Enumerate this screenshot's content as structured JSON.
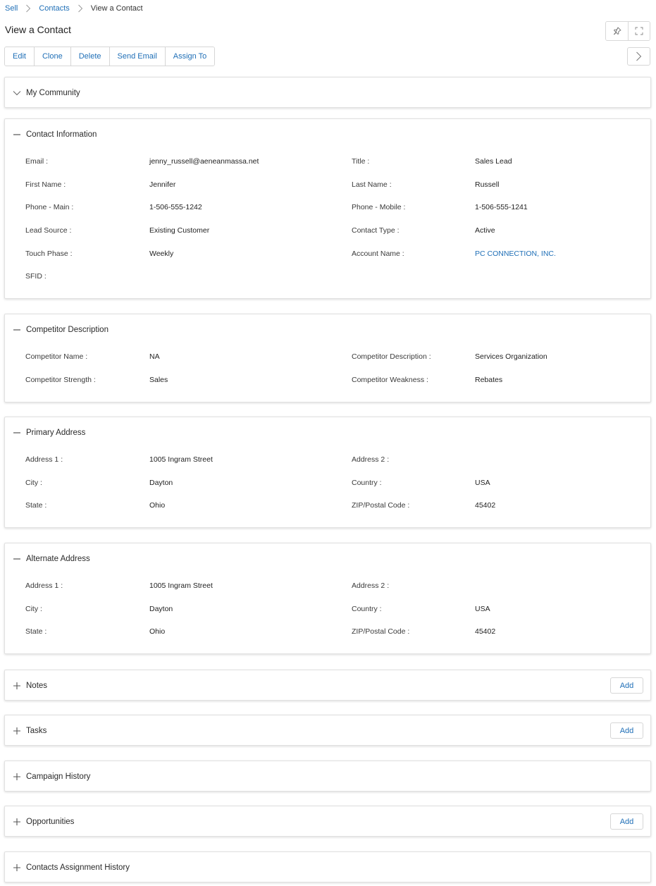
{
  "breadcrumb": {
    "items": [
      {
        "label": "Sell"
      },
      {
        "label": "Contacts"
      }
    ],
    "current": "View a Contact"
  },
  "page": {
    "title": "View a Contact"
  },
  "toolbar": {
    "tools": [
      {
        "icon": "pin-icon"
      },
      {
        "icon": "fullscreen-icon"
      }
    ],
    "actions": [
      "Edit",
      "Clone",
      "Delete",
      "Send Email",
      "Assign To"
    ],
    "next_icon": "chevron-right-icon"
  },
  "colors": {
    "link": "#1f6fb7",
    "border": "#d6d6d6"
  },
  "sections": {
    "my_community": {
      "title": "My Community",
      "state": "collapsed",
      "icon": "chevron-down-icon"
    },
    "contact_info": {
      "title": "Contact Information",
      "state": "expanded",
      "icon": "minus-icon",
      "rows": [
        [
          {
            "label": "Email :",
            "value": "jenny_russell@aeneanmassa.net"
          },
          {
            "label": "Title :",
            "value": "Sales Lead"
          }
        ],
        [
          {
            "label": "First Name :",
            "value": "Jennifer"
          },
          {
            "label": "Last Name :",
            "value": "Russell"
          }
        ],
        [
          {
            "label": "Phone - Main :",
            "value": "1-506-555-1242"
          },
          {
            "label": "Phone - Mobile :",
            "value": "1-506-555-1241"
          }
        ],
        [
          {
            "label": "Lead Source :",
            "value": "Existing Customer"
          },
          {
            "label": "Contact Type :",
            "value": "Active"
          }
        ],
        [
          {
            "label": "Touch Phase :",
            "value": "Weekly"
          },
          {
            "label": "Account Name :",
            "value": "PC CONNECTION, INC."
          }
        ],
        [
          {
            "label": "SFID :",
            "value": ""
          }
        ]
      ]
    },
    "competitor": {
      "title": "Competitor Description",
      "state": "expanded",
      "icon": "minus-icon",
      "rows": [
        [
          {
            "label": "Competitor Name :",
            "value": "NA"
          },
          {
            "label": "Competitor Description :",
            "value": "Services Organization"
          }
        ],
        [
          {
            "label": "Competitor Strength :",
            "value": "Sales"
          },
          {
            "label": "Competitor Weakness :",
            "value": "Rebates"
          }
        ]
      ]
    },
    "primary_address": {
      "title": "Primary Address",
      "state": "expanded",
      "icon": "minus-icon",
      "rows": [
        [
          {
            "label": "Address 1 :",
            "value": "1005 Ingram Street"
          },
          {
            "label": "Address 2 :",
            "value": ""
          }
        ],
        [
          {
            "label": "City :",
            "value": "Dayton"
          },
          {
            "label": "Country :",
            "value": "USA"
          }
        ],
        [
          {
            "label": "State :",
            "value": "Ohio"
          },
          {
            "label": "ZIP/Postal Code :",
            "value": "45402"
          }
        ]
      ]
    },
    "alternate_address": {
      "title": "Alternate Address",
      "state": "expanded",
      "icon": "minus-icon",
      "rows": [
        [
          {
            "label": "Address 1 :",
            "value": "1005 Ingram Street"
          },
          {
            "label": "Address 2 :",
            "value": ""
          }
        ],
        [
          {
            "label": "City :",
            "value": "Dayton"
          },
          {
            "label": "Country :",
            "value": "USA"
          }
        ],
        [
          {
            "label": "State :",
            "value": "Ohio"
          },
          {
            "label": "ZIP/Postal Code :",
            "value": "45402"
          }
        ]
      ]
    },
    "notes": {
      "title": "Notes",
      "state": "collapsed",
      "icon": "plus-icon",
      "add_label": "Add"
    },
    "tasks": {
      "title": "Tasks",
      "state": "collapsed",
      "icon": "plus-icon",
      "add_label": "Add"
    },
    "campaign_history": {
      "title": "Campaign History",
      "state": "collapsed",
      "icon": "plus-icon"
    },
    "opportunities": {
      "title": "Opportunities",
      "state": "collapsed",
      "icon": "plus-icon",
      "add_label": "Add"
    },
    "assignment_history": {
      "title": "Contacts Assignment History",
      "state": "collapsed",
      "icon": "plus-icon"
    }
  }
}
